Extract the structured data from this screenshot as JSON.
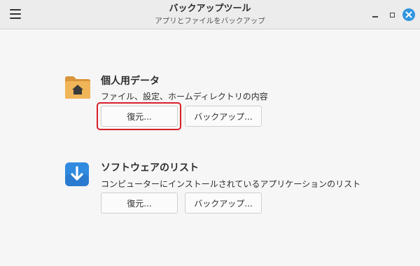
{
  "window": {
    "title": "バックアップツール",
    "subtitle": "アプリとファイルをバックアップ"
  },
  "sections": {
    "personal": {
      "icon": "folder-home-icon",
      "title": "個人用データ",
      "description": "ファイル、設定、ホームディレクトリの内容",
      "restore_label": "復元...",
      "backup_label": "バックアップ..."
    },
    "software": {
      "icon": "download-arrow-icon",
      "title": "ソフトウェアのリスト",
      "description": "コンピューターにインストールされているアプリケーションのリスト",
      "restore_label": "復元...",
      "backup_label": "バックアップ..."
    }
  },
  "colors": {
    "folder": "#e8a84c",
    "download_icon": "#2f8ae0",
    "highlight": "#d9202a",
    "close_button": "#2f95e0"
  }
}
